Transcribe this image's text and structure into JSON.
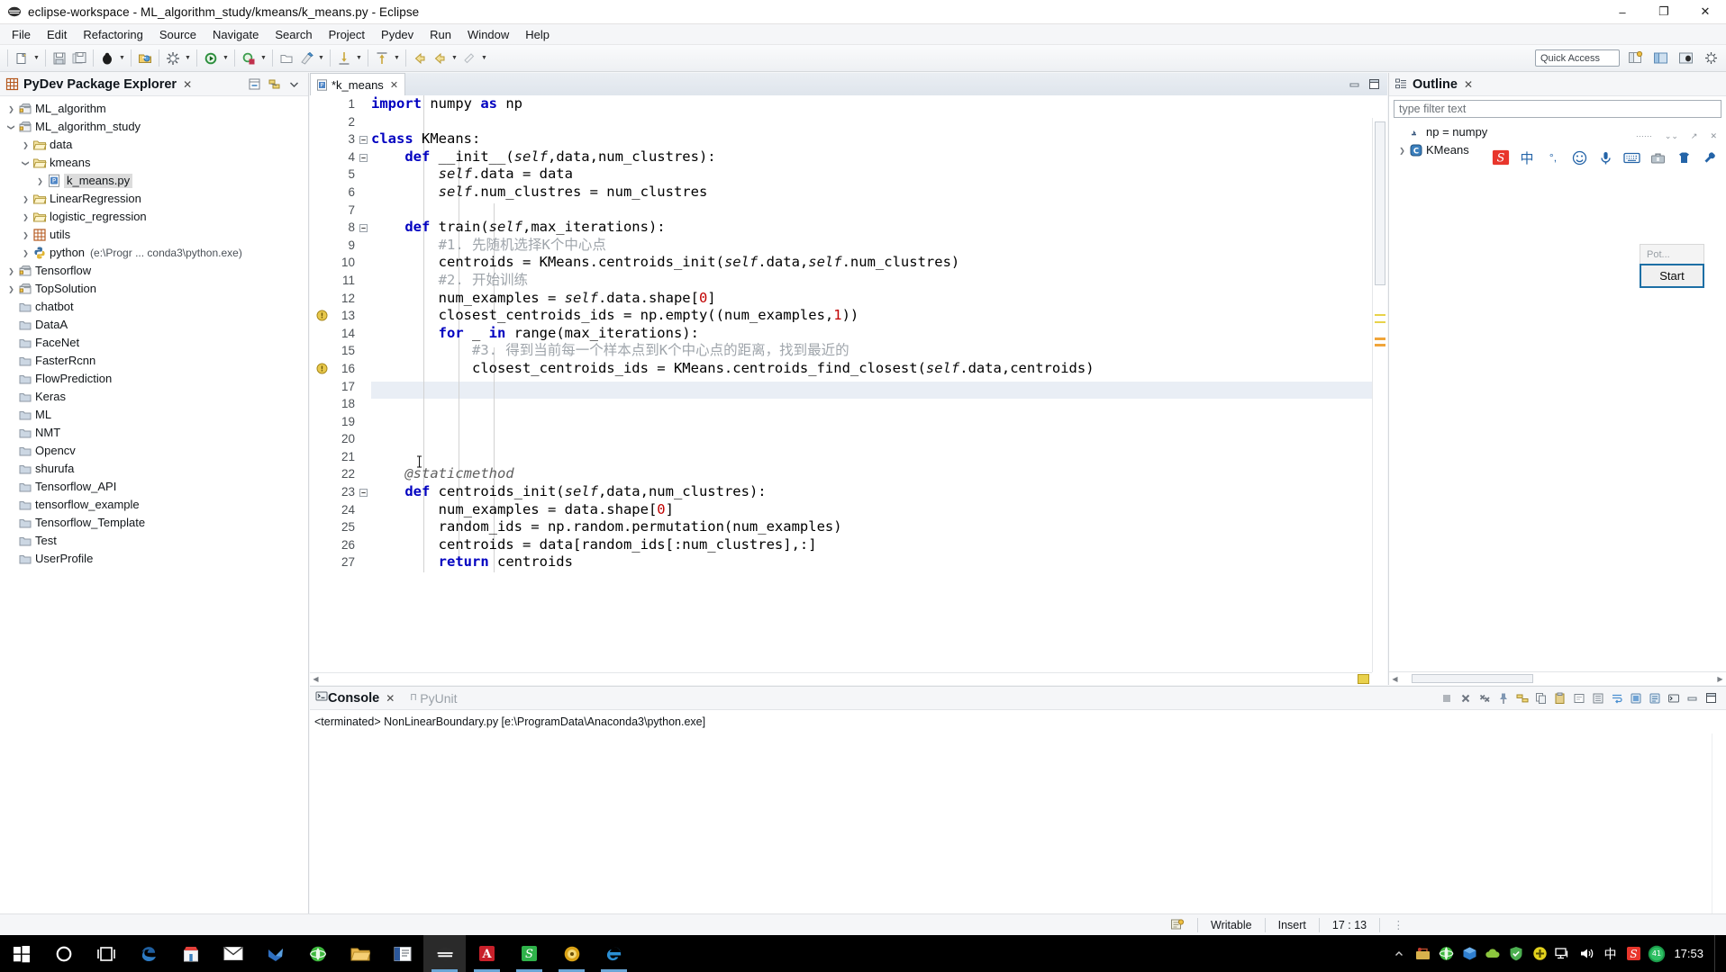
{
  "window": {
    "title": "eclipse-workspace - ML_algorithm_study/kmeans/k_means.py - Eclipse",
    "minimize": "–",
    "maximize": "❐",
    "close": "✕"
  },
  "menu": [
    "File",
    "Edit",
    "Refactoring",
    "Source",
    "Navigate",
    "Search",
    "Project",
    "Pydev",
    "Run",
    "Window",
    "Help"
  ],
  "toolbar": {
    "quick_access": "Quick Access",
    "icons": [
      "new-wizard-icon",
      "save-icon",
      "save-all-icon",
      "debug-icon",
      "open-type-icon",
      "build-icon",
      "run-icon",
      "coverage-icon",
      "new-folder-icon",
      "pydev-icon",
      "step-into-icon",
      "step-return-icon",
      "back-icon",
      "forward-icon",
      "annotate-icon"
    ]
  },
  "package_explorer": {
    "title": "PyDev Package Explorer",
    "close": "✕",
    "items": [
      {
        "label": "ML_algorithm",
        "icon": "project-icon",
        "indent": 0,
        "expander": "collapsed",
        "selected": false
      },
      {
        "label": "ML_algorithm_study",
        "icon": "project-icon",
        "indent": 0,
        "expander": "expanded",
        "selected": false
      },
      {
        "label": "data",
        "icon": "folder-icon",
        "indent": 1,
        "expander": "collapsed",
        "selected": false
      },
      {
        "label": "kmeans",
        "icon": "folder-icon",
        "indent": 1,
        "expander": "expanded",
        "selected": false
      },
      {
        "label": "k_means.py",
        "icon": "python-file-icon",
        "indent": 2,
        "expander": "collapsed",
        "selected": true
      },
      {
        "label": "LinearRegression",
        "icon": "folder-icon",
        "indent": 1,
        "expander": "collapsed",
        "selected": false
      },
      {
        "label": "logistic_regression",
        "icon": "folder-icon",
        "indent": 1,
        "expander": "collapsed",
        "selected": false
      },
      {
        "label": "utils",
        "icon": "package-icon",
        "indent": 1,
        "expander": "collapsed",
        "selected": false
      },
      {
        "label": "python",
        "sub": "(e:\\Progr ... conda3\\python.exe)",
        "icon": "python-interpreter-icon",
        "indent": 1,
        "expander": "collapsed",
        "selected": false
      },
      {
        "label": "Tensorflow",
        "icon": "project-icon",
        "indent": 0,
        "expander": "collapsed",
        "selected": false
      },
      {
        "label": "TopSolution",
        "icon": "project-icon",
        "indent": 0,
        "expander": "collapsed",
        "selected": false
      },
      {
        "label": "chatbot",
        "icon": "closed-project-icon",
        "indent": 0,
        "expander": "none",
        "selected": false
      },
      {
        "label": "DataA",
        "icon": "closed-project-icon",
        "indent": 0,
        "expander": "none",
        "selected": false
      },
      {
        "label": "FaceNet",
        "icon": "closed-project-icon",
        "indent": 0,
        "expander": "none",
        "selected": false
      },
      {
        "label": "FasterRcnn",
        "icon": "closed-project-icon",
        "indent": 0,
        "expander": "none",
        "selected": false
      },
      {
        "label": "FlowPrediction",
        "icon": "closed-project-icon",
        "indent": 0,
        "expander": "none",
        "selected": false
      },
      {
        "label": "Keras",
        "icon": "closed-project-icon",
        "indent": 0,
        "expander": "none",
        "selected": false
      },
      {
        "label": "ML",
        "icon": "closed-project-icon",
        "indent": 0,
        "expander": "none",
        "selected": false
      },
      {
        "label": "NMT",
        "icon": "closed-project-icon",
        "indent": 0,
        "expander": "none",
        "selected": false
      },
      {
        "label": "Opencv",
        "icon": "closed-project-icon",
        "indent": 0,
        "expander": "none",
        "selected": false
      },
      {
        "label": "shurufa",
        "icon": "closed-project-icon",
        "indent": 0,
        "expander": "none",
        "selected": false
      },
      {
        "label": "Tensorflow_API",
        "icon": "closed-project-icon",
        "indent": 0,
        "expander": "none",
        "selected": false
      },
      {
        "label": "tensorflow_example",
        "icon": "closed-project-icon",
        "indent": 0,
        "expander": "none",
        "selected": false
      },
      {
        "label": "Tensorflow_Template",
        "icon": "closed-project-icon",
        "indent": 0,
        "expander": "none",
        "selected": false
      },
      {
        "label": "Test",
        "icon": "closed-project-icon",
        "indent": 0,
        "expander": "none",
        "selected": false
      },
      {
        "label": "UserProfile",
        "icon": "closed-project-icon",
        "indent": 0,
        "expander": "none",
        "selected": false
      }
    ]
  },
  "editor": {
    "tab_label": "*k_means",
    "tab_close": "✕",
    "tab_icon": "python-file-icon",
    "minimize": "–",
    "maximize": "❐",
    "caret_line": 17,
    "lines": [
      {
        "n": 1,
        "marker": "none",
        "fold": "none",
        "text": "import numpy as np"
      },
      {
        "n": 2,
        "marker": "none",
        "fold": "none",
        "text": ""
      },
      {
        "n": 3,
        "marker": "none",
        "fold": "fold",
        "text": "class KMeans:"
      },
      {
        "n": 4,
        "marker": "none",
        "fold": "fold",
        "text": "    def __init__(self,data,num_clustres):"
      },
      {
        "n": 5,
        "marker": "none",
        "fold": "none",
        "text": "        self.data = data"
      },
      {
        "n": 6,
        "marker": "none",
        "fold": "none",
        "text": "        self.num_clustres = num_clustres"
      },
      {
        "n": 7,
        "marker": "none",
        "fold": "none",
        "text": ""
      },
      {
        "n": 8,
        "marker": "none",
        "fold": "fold",
        "text": "    def train(self,max_iterations):"
      },
      {
        "n": 9,
        "marker": "none",
        "fold": "none",
        "text": "        #1. 先随机选择K个中心点"
      },
      {
        "n": 10,
        "marker": "none",
        "fold": "none",
        "text": "        centroids = KMeans.centroids_init(self.data,self.num_clustres)"
      },
      {
        "n": 11,
        "marker": "none",
        "fold": "none",
        "text": "        #2. 开始训练"
      },
      {
        "n": 12,
        "marker": "none",
        "fold": "none",
        "text": "        num_examples = self.data.shape[0]"
      },
      {
        "n": 13,
        "marker": "warning",
        "fold": "none",
        "text": "        closest_centroids_ids = np.empty((num_examples,1))"
      },
      {
        "n": 14,
        "marker": "none",
        "fold": "none",
        "text": "        for _ in range(max_iterations):"
      },
      {
        "n": 15,
        "marker": "none",
        "fold": "none",
        "text": "            #3. 得到当前每一个样本点到K个中心点的距离，找到最近的"
      },
      {
        "n": 16,
        "marker": "warning",
        "fold": "none",
        "text": "            closest_centroids_ids = KMeans.centroids_find_closest(self.data,centroids)"
      },
      {
        "n": 17,
        "marker": "none",
        "fold": "none",
        "text": "            "
      },
      {
        "n": 18,
        "marker": "none",
        "fold": "none",
        "text": ""
      },
      {
        "n": 19,
        "marker": "none",
        "fold": "none",
        "text": ""
      },
      {
        "n": 20,
        "marker": "none",
        "fold": "none",
        "text": ""
      },
      {
        "n": 21,
        "marker": "none",
        "fold": "none",
        "text": "    "
      },
      {
        "n": 22,
        "marker": "none",
        "fold": "none",
        "text": "    @staticmethod"
      },
      {
        "n": 23,
        "marker": "none",
        "fold": "fold",
        "text": "    def centroids_init(self,data,num_clustres):"
      },
      {
        "n": 24,
        "marker": "none",
        "fold": "none",
        "text": "        num_examples = data.shape[0]"
      },
      {
        "n": 25,
        "marker": "none",
        "fold": "none",
        "text": "        random_ids = np.random.permutation(num_examples)"
      },
      {
        "n": 26,
        "marker": "none",
        "fold": "none",
        "text": "        centroids = data[random_ids[:num_clustres],:]"
      },
      {
        "n": 27,
        "marker": "none",
        "fold": "none",
        "text": "        return centroids"
      }
    ]
  },
  "outline": {
    "title": "Outline",
    "close": "✕",
    "filter_placeholder": "type filter text",
    "filter_value": "",
    "items": [
      {
        "label": "np = numpy",
        "icon": "import-icon",
        "expander": "none"
      },
      {
        "label": "KMeans",
        "icon": "class-icon",
        "expander": "collapsed"
      }
    ]
  },
  "ime": {
    "logo": "sogou-logo-icon",
    "buttons": [
      "chinese-mode-icon",
      "punctuation-icon",
      "emoji-icon",
      "voice-input-icon",
      "soft-keyboard-icon",
      "toolbox-icon",
      "skin-icon",
      "settings-icon"
    ]
  },
  "popup": {
    "title": "Pot...",
    "button": "Start"
  },
  "console": {
    "tabs": [
      {
        "label": "Console",
        "icon": "console-icon",
        "active": true,
        "close": "✕"
      },
      {
        "label": "PyUnit",
        "icon": "pyunit-icon",
        "active": false
      }
    ],
    "output": "<terminated> NonLinearBoundary.py [e:\\ProgramData\\Anaconda3\\python.exe]",
    "tool_icons": [
      "terminate-icon",
      "remove-launch-icon",
      "remove-all-icon",
      "pin-icon",
      "link-icon",
      "copy-icon",
      "paste-icon",
      "clear-icon",
      "scroll-lock-icon",
      "word-wrap-icon",
      "pin-console-icon",
      "display-selected-icon",
      "open-console-icon",
      "minimize-icon",
      "maximize-icon"
    ]
  },
  "status_bar": {
    "writable": "Writable",
    "insert": "Insert",
    "position": "17 : 13",
    "icon": "smart-insert-icon"
  },
  "taskbar": {
    "items": [
      {
        "name": "start-button",
        "icon": "windows-logo-icon"
      },
      {
        "name": "cortana-button",
        "icon": "cortana-circle-icon"
      },
      {
        "name": "task-view-button",
        "icon": "task-view-icon"
      },
      {
        "name": "edge-taskbar-button",
        "icon": "edge-icon"
      },
      {
        "name": "store-taskbar-button",
        "icon": "store-icon"
      },
      {
        "name": "mail-taskbar-button",
        "icon": "mail-icon"
      },
      {
        "name": "foxmail-taskbar-button",
        "icon": "foxmail-icon"
      },
      {
        "name": "browser-taskbar-button",
        "icon": "green-browser-icon"
      },
      {
        "name": "explorer-taskbar-button",
        "icon": "folder-explorer-icon"
      },
      {
        "name": "word-taskbar-button",
        "icon": "word-icon"
      },
      {
        "name": "eclipse-taskbar-button",
        "icon": "eclipse-icon",
        "active": true,
        "open": true
      },
      {
        "name": "pdf-taskbar-button",
        "icon": "acrobat-icon",
        "open": true
      },
      {
        "name": "sogou-taskbar-button",
        "icon": "sogou-green-icon",
        "open": true
      },
      {
        "name": "media-taskbar-button",
        "icon": "media-icon",
        "open": true
      },
      {
        "name": "ie-taskbar-button",
        "icon": "ie-icon",
        "open": true
      }
    ],
    "tray": [
      "tray-expand-icon",
      "netease-icon",
      "green-browser-tray-icon",
      "box-tray-icon",
      "cloud-tray-icon",
      "shield-tray-icon",
      "plus-tray-icon",
      "network-icon",
      "volume-icon",
      "ime-chinese-icon",
      "sogou-tray-icon",
      "battery-41-icon"
    ],
    "tray_battery_label": "41",
    "ime_label": "中",
    "clock": "17:53"
  }
}
